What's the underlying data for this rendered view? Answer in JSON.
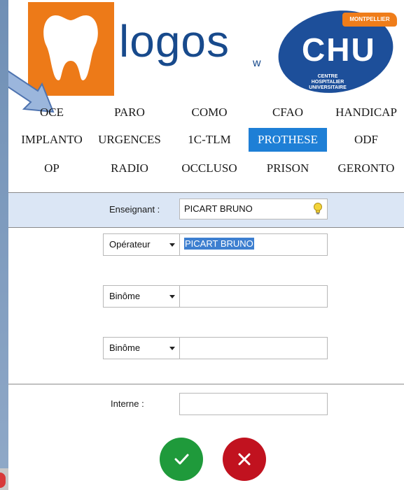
{
  "header": {
    "logo_text": "logos",
    "logo_suffix": "w",
    "chu": {
      "badge": "MONTPELLIER",
      "title": "CHU",
      "subtitle_line1": "CENTRE HOSPITALIER",
      "subtitle_line2": "UNIVERSITAIRE"
    }
  },
  "tabs": {
    "row1": [
      "OCE",
      "PARO",
      "COMO",
      "CFAO",
      "HANDICAP"
    ],
    "row2": [
      "IMPLANTO",
      "URGENCES",
      "1C-TLM",
      "PROTHESE",
      "ODF"
    ],
    "row3": [
      "OP",
      "RADIO",
      "OCCLUSO",
      "PRISON",
      "GERONTO"
    ],
    "active": "PROTHESE"
  },
  "enseignant": {
    "label": "Enseignant :",
    "value": "PICART BRUNO"
  },
  "operateur": {
    "dropdown": "Opérateur",
    "value": "PICART BRUNO"
  },
  "binome1": {
    "dropdown": "Binôme",
    "value": ""
  },
  "binome2": {
    "dropdown": "Binôme",
    "value": ""
  },
  "interne": {
    "label": "Interne :",
    "value": ""
  },
  "colors": {
    "accent": "#1e7fd6",
    "ok": "#1f9a3b",
    "cancel": "#c1121f",
    "orange": "#ed7a18",
    "chu_blue": "#1d4f9a"
  }
}
